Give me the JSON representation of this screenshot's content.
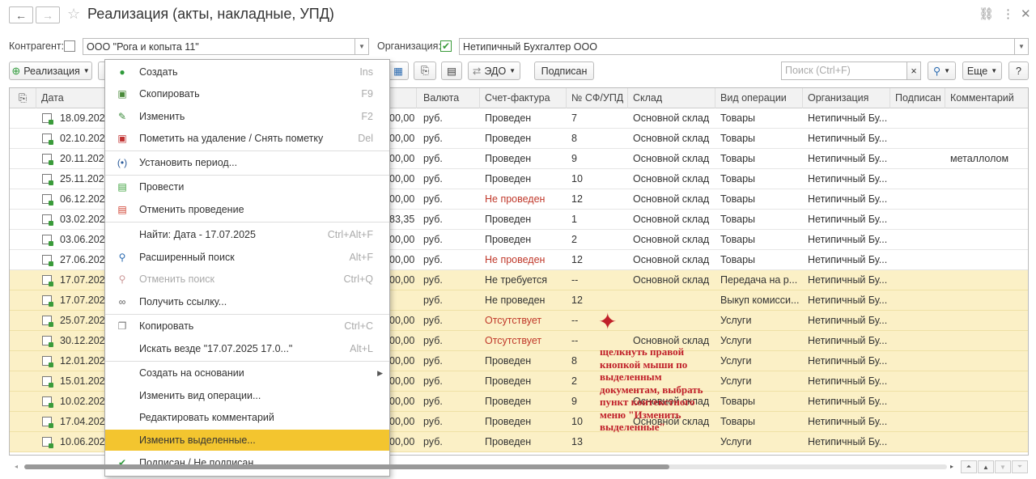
{
  "window": {
    "title": "Реализация (акты, накладные, УПД)"
  },
  "filters": {
    "counterparty_label": "Контрагент:",
    "counterparty_value": "ООО \"Рога и копыта 11\"",
    "organization_label": "Организация:",
    "organization_value": "Нетипичный Бухгалтер ООО"
  },
  "toolbar": {
    "realization_label": "Реализация",
    "edo_label": "ЭДО",
    "signed_label": "Подписан",
    "search_placeholder": "Поиск (Ctrl+F)",
    "clear_symbol": "×",
    "more_label": "Еще",
    "help_label": "?"
  },
  "columns": [
    "Дата",
    "Валюта",
    "Счет-фактура",
    "№ СФ/УПД",
    "Склад",
    "Вид операции",
    "Организация",
    "Подписан",
    "Комментарий"
  ],
  "rows": [
    {
      "date": "18.09.2024",
      "sum": "00,00",
      "currency": "руб.",
      "invoice": "Проведен",
      "num": "7",
      "warehouse": "Основной склад",
      "op": "Товары",
      "org": "Нетипичный Бу...",
      "comment": "",
      "selected": false,
      "red": false
    },
    {
      "date": "02.10.2024",
      "sum": "00,00",
      "currency": "руб.",
      "invoice": "Проведен",
      "num": "8",
      "warehouse": "Основной склад",
      "op": "Товары",
      "org": "Нетипичный Бу...",
      "comment": "",
      "selected": false,
      "red": false
    },
    {
      "date": "20.11.2024",
      "sum": "00,00",
      "currency": "руб.",
      "invoice": "Проведен",
      "num": "9",
      "warehouse": "Основной склад",
      "op": "Товары",
      "org": "Нетипичный Бу...",
      "comment": "металлолом",
      "selected": false,
      "red": false
    },
    {
      "date": "25.11.2024",
      "sum": "00,00",
      "currency": "руб.",
      "invoice": "Проведен",
      "num": "10",
      "warehouse": "Основной склад",
      "op": "Товары",
      "org": "Нетипичный Бу...",
      "comment": "",
      "selected": false,
      "red": false
    },
    {
      "date": "06.12.2024",
      "sum": "00,00",
      "currency": "руб.",
      "invoice": "Не проведен",
      "num": "12",
      "warehouse": "Основной склад",
      "op": "Товары",
      "org": "Нетипичный Бу...",
      "comment": "",
      "selected": false,
      "red": true
    },
    {
      "date": "03.02.2025",
      "sum": "83,35",
      "currency": "руб.",
      "invoice": "Проведен",
      "num": "1",
      "warehouse": "Основной склад",
      "op": "Товары",
      "org": "Нетипичный Бу...",
      "comment": "",
      "selected": false,
      "red": false
    },
    {
      "date": "03.06.2025",
      "sum": "00,00",
      "currency": "руб.",
      "invoice": "Проведен",
      "num": "2",
      "warehouse": "Основной склад",
      "op": "Товары",
      "org": "Нетипичный Бу...",
      "comment": "",
      "selected": false,
      "red": false
    },
    {
      "date": "27.06.2025",
      "sum": "00,00",
      "currency": "руб.",
      "invoice": "Не проведен",
      "num": "12",
      "warehouse": "Основной склад",
      "op": "Товары",
      "org": "Нетипичный Бу...",
      "comment": "",
      "selected": false,
      "red": true
    },
    {
      "date": "17.07.2025",
      "sum": "00,00",
      "currency": "руб.",
      "invoice": "Не требуется",
      "num": "--",
      "warehouse": "Основной склад",
      "op": "Передача на р...",
      "org": "Нетипичный Бу...",
      "comment": "",
      "selected": true,
      "red": false
    },
    {
      "date": "17.07.2025",
      "sum": "",
      "currency": "руб.",
      "invoice": "Не проведен",
      "num": "12",
      "warehouse": "",
      "op": "Выкуп комисси...",
      "org": "Нетипичный Бу...",
      "comment": "",
      "selected": true,
      "red": false
    },
    {
      "date": "25.07.2025",
      "sum": "00,00",
      "currency": "руб.",
      "invoice": "Отсутствует",
      "num": "--",
      "warehouse": "",
      "op": "Услуги",
      "org": "Нетипичный Бу...",
      "comment": "",
      "selected": true,
      "red": true
    },
    {
      "date": "30.12.2025",
      "sum": "00,00",
      "currency": "руб.",
      "invoice": "Отсутствует",
      "num": "--",
      "warehouse": "Основной склад",
      "op": "Услуги",
      "org": "Нетипичный Бу...",
      "comment": "",
      "selected": true,
      "red": true
    },
    {
      "date": "12.01.2026",
      "sum": "00,00",
      "currency": "руб.",
      "invoice": "Проведен",
      "num": "8",
      "warehouse": "",
      "op": "Услуги",
      "org": "Нетипичный Бу...",
      "comment": "",
      "selected": true,
      "red": false
    },
    {
      "date": "15.01.2026",
      "sum": "00,00",
      "currency": "руб.",
      "invoice": "Проведен",
      "num": "2",
      "warehouse": "",
      "op": "Услуги",
      "org": "Нетипичный Бу...",
      "comment": "",
      "selected": true,
      "red": false
    },
    {
      "date": "10.02.2026",
      "sum": "00,00",
      "currency": "руб.",
      "invoice": "Проведен",
      "num": "9",
      "warehouse": "Основной склад",
      "op": "Товары",
      "org": "Нетипичный Бу...",
      "comment": "",
      "selected": true,
      "red": false
    },
    {
      "date": "17.04.2026",
      "sum": "00,00",
      "currency": "руб.",
      "invoice": "Проведен",
      "num": "10",
      "warehouse": "Основной склад",
      "op": "Товары",
      "org": "Нетипичный Бу...",
      "comment": "",
      "selected": true,
      "red": false
    },
    {
      "date": "10.06.2026",
      "sum": "00,00",
      "currency": "руб.",
      "invoice": "Проведен",
      "num": "13",
      "warehouse": "",
      "op": "Услуги",
      "org": "Нетипичный Бу...",
      "comment": "",
      "selected": true,
      "red": false
    }
  ],
  "context_menu": [
    {
      "label": "Создать",
      "shortcut": "Ins",
      "icon": "plus-icon",
      "glyph": "●",
      "color": "#2e9a3a"
    },
    {
      "label": "Скопировать",
      "shortcut": "F9",
      "icon": "copy-icon",
      "glyph": "▣",
      "color": "#4a8a3a"
    },
    {
      "label": "Изменить",
      "shortcut": "F2",
      "icon": "pencil-icon",
      "glyph": "✎",
      "color": "#3a8a3a"
    },
    {
      "label": "Пометить на удаление / Снять пометку",
      "shortcut": "Del",
      "icon": "delete-mark-icon",
      "glyph": "▣",
      "color": "#c03030"
    },
    {
      "label": "Установить период...",
      "shortcut": "",
      "icon": "period-icon",
      "glyph": "(•)",
      "color": "#2a5a9a"
    },
    {
      "label": "Провести",
      "shortcut": "",
      "icon": "post-icon",
      "glyph": "▤",
      "color": "#3aa03a"
    },
    {
      "label": "Отменить проведение",
      "shortcut": "",
      "icon": "unpost-icon",
      "glyph": "▤",
      "color": "#d04030"
    },
    {
      "label": "Найти: Дата - 17.07.2025",
      "shortcut": "Ctrl+Alt+F",
      "icon": "",
      "glyph": "",
      "color": "#333"
    },
    {
      "label": "Расширенный поиск",
      "shortcut": "Alt+F",
      "icon": "search-icon",
      "glyph": "⚲",
      "color": "#2a6ab0"
    },
    {
      "label": "Отменить поиск",
      "shortcut": "Ctrl+Q",
      "icon": "cancel-search-icon",
      "glyph": "⚲",
      "color": "#c99"
    },
    {
      "label": "Получить ссылку...",
      "shortcut": "",
      "icon": "link-icon",
      "glyph": "∞",
      "color": "#555"
    },
    {
      "label": "Копировать",
      "shortcut": "Ctrl+C",
      "icon": "clipboard-icon",
      "glyph": "❐",
      "color": "#777"
    },
    {
      "label": "Искать везде \"17.07.2025 17.0...\"",
      "shortcut": "Alt+L",
      "icon": "",
      "glyph": "",
      "color": "#333"
    },
    {
      "label": "Создать на основании",
      "shortcut": "",
      "icon": "",
      "glyph": "",
      "color": "#333"
    },
    {
      "label": "Изменить вид операции...",
      "shortcut": "",
      "icon": "",
      "glyph": "",
      "color": "#333"
    },
    {
      "label": "Редактировать комментарий",
      "shortcut": "",
      "icon": "",
      "glyph": "",
      "color": "#333"
    },
    {
      "label": "Изменить выделенные...",
      "shortcut": "",
      "icon": "",
      "glyph": "",
      "color": "#333"
    },
    {
      "label": "Подписан / Не подписан",
      "shortcut": "",
      "icon": "check-icon",
      "glyph": "✔",
      "color": "#2e9a3a"
    }
  ],
  "annotation": "щелкнуть правой кнопкой мыши по выделенным документам, выбрать пункт контекстного меню \"Изменить выделенные\""
}
